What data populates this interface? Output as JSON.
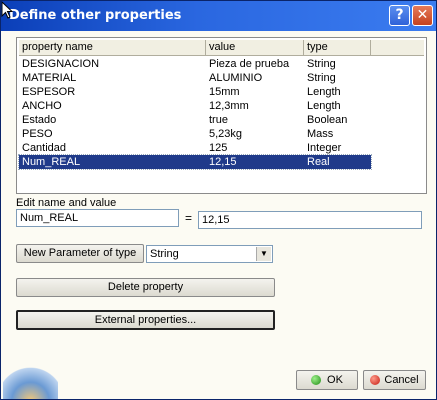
{
  "window": {
    "title": "Define other properties",
    "help_label": "?",
    "close_label": "✕"
  },
  "table": {
    "headers": [
      "property name",
      "value",
      "type"
    ],
    "rows": [
      {
        "name": "DESIGNACION",
        "value": "Pieza de prueba",
        "type": "String"
      },
      {
        "name": "MATERIAL",
        "value": "ALUMINIO",
        "type": "String"
      },
      {
        "name": "ESPESOR",
        "value": "15mm",
        "type": "Length"
      },
      {
        "name": "ANCHO",
        "value": "12,3mm",
        "type": "Length"
      },
      {
        "name": "Estado",
        "value": "true",
        "type": "Boolean"
      },
      {
        "name": "PESO",
        "value": "5,23kg",
        "type": "Mass"
      },
      {
        "name": "Cantidad",
        "value": "125",
        "type": "Integer"
      },
      {
        "name": "Num_REAL",
        "value": "12,15",
        "type": "Real",
        "selected": true
      }
    ]
  },
  "edit": {
    "label": "Edit name and value",
    "name_value": "Num_REAL",
    "equals": "=",
    "value_value": "12,15"
  },
  "new_param": {
    "button_label": "New Parameter of type",
    "selected_type": "String"
  },
  "buttons": {
    "delete": "Delete property",
    "external": "External properties...",
    "ok": "OK",
    "cancel": "Cancel"
  }
}
